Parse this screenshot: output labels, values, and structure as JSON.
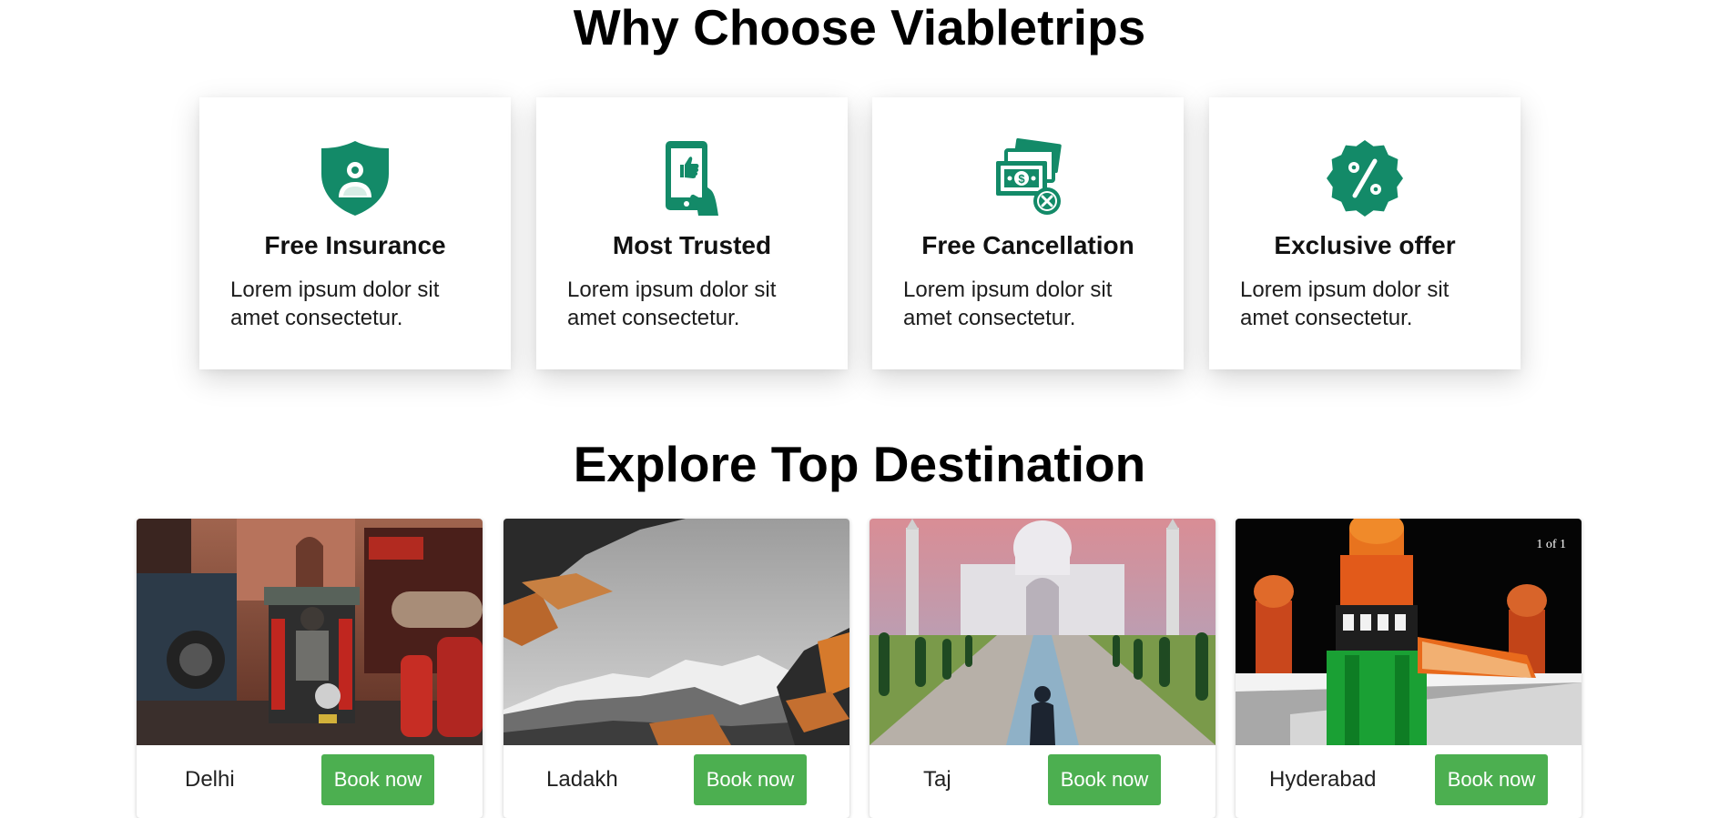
{
  "why_section": {
    "title": "Why Choose Viabletrips",
    "features": [
      {
        "icon": "shield-person-icon",
        "title": "Free Insurance",
        "text": "Lorem ipsum dolor sit amet consectetur."
      },
      {
        "icon": "tablet-thumbs-up-icon",
        "title": "Most Trusted",
        "text": "Lorem ipsum dolor sit amet consectetur."
      },
      {
        "icon": "cash-cancel-icon",
        "title": "Free Cancellation",
        "text": "Lorem ipsum dolor sit amet consectetur."
      },
      {
        "icon": "percent-badge-icon",
        "title": "Exclusive offer",
        "text": "Lorem ipsum dolor sit amet consectetur."
      }
    ]
  },
  "destinations_section": {
    "title": "Explore Top Destination",
    "cards": [
      {
        "name": "Delhi",
        "button": "Book now"
      },
      {
        "name": "Ladakh",
        "button": "Book now"
      },
      {
        "name": "Taj",
        "button": "Book now"
      },
      {
        "name": "Hyderabad",
        "button": "Book now",
        "counter": "1 of 1"
      }
    ]
  },
  "colors": {
    "accent_green": "#138a68",
    "button_green": "#4caf50"
  }
}
